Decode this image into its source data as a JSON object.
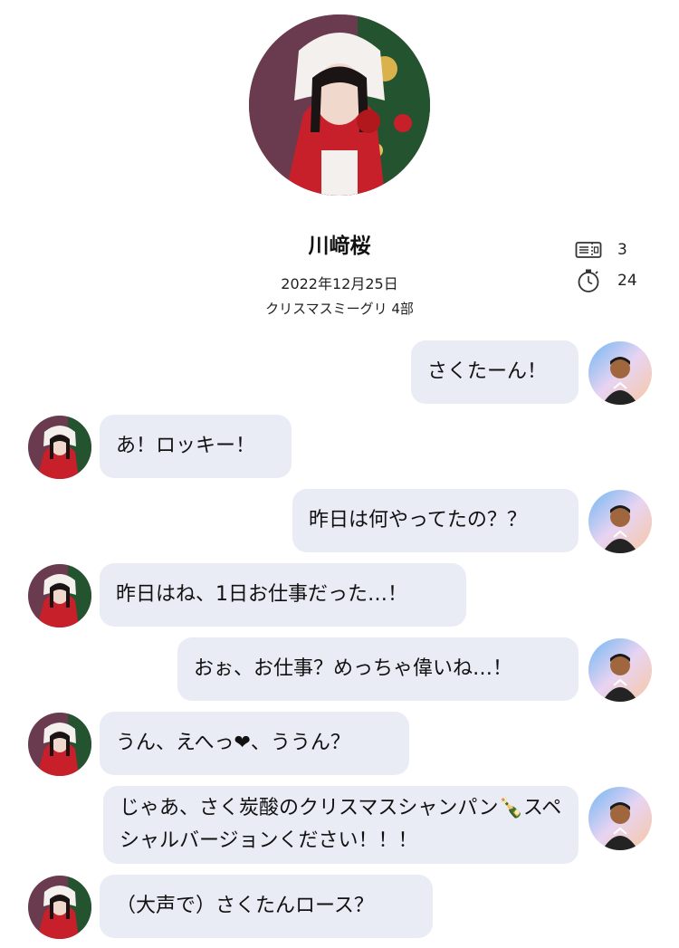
{
  "profile": {
    "name": "川﨑桜",
    "date": "2022年12月25日",
    "event": "クリスマスミーグリ 4部"
  },
  "stats": [
    {
      "icon": "ticket-icon",
      "value": "3"
    },
    {
      "icon": "stopwatch-icon",
      "value": "24"
    }
  ],
  "messages": [
    {
      "from": "user",
      "text": "さくたーん！"
    },
    {
      "from": "idol",
      "text": "あ！ロッキー！"
    },
    {
      "from": "user",
      "text": "昨日は何やってたの？？"
    },
    {
      "from": "idol",
      "text": "昨日はね、1日お仕事だった…！"
    },
    {
      "from": "user",
      "text": "おぉ、お仕事？めっちゃ偉いね…！"
    },
    {
      "from": "idol",
      "text": "うん、えへっ❤、ううん？"
    },
    {
      "from": "user",
      "text": "じゃあ、さく炭酸のクリスマスシャンパン🍾スペシャルバージョンください！！！"
    },
    {
      "from": "idol",
      "text": "（大声で）さくたんロース？"
    }
  ],
  "colors": {
    "bubble": "#e9ecf5",
    "santa_red": "#c8202a",
    "tree_green": "#1f5a2e"
  }
}
